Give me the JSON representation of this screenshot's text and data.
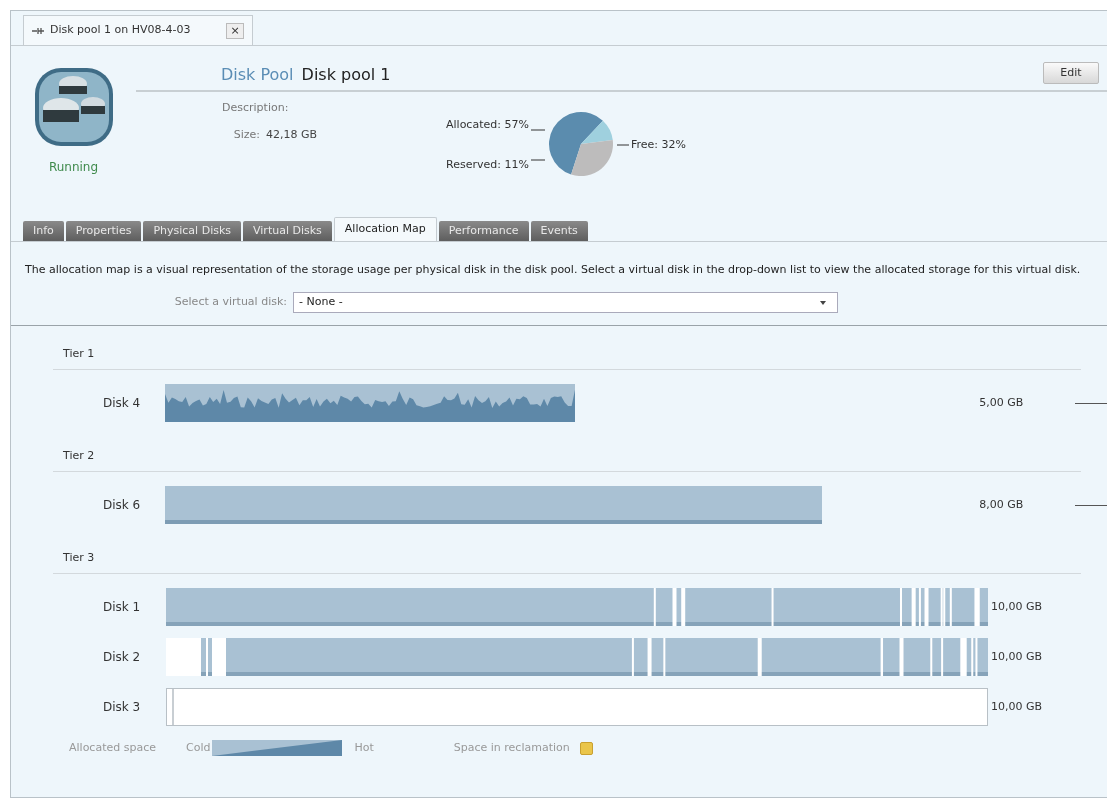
{
  "document_tab": {
    "title": "Disk pool 1 on HV08-4-03",
    "close": "×"
  },
  "header": {
    "status": "Running",
    "type_label": "Disk Pool",
    "name": "Disk pool 1",
    "description_label": "Description:",
    "size_label": "Size:",
    "size_value": "42,18 GB",
    "edit_button": "Edit",
    "chart_data": {
      "type": "pie",
      "categories": [
        "Allocated: 57%",
        "Reserved: 11%",
        "Free: 32%"
      ],
      "values": [
        57,
        11,
        32
      ]
    }
  },
  "tabs": [
    {
      "label": "Info",
      "selected": false
    },
    {
      "label": "Properties",
      "selected": false
    },
    {
      "label": "Physical Disks",
      "selected": false
    },
    {
      "label": "Virtual Disks",
      "selected": false
    },
    {
      "label": "Allocation Map",
      "selected": true
    },
    {
      "label": "Performance",
      "selected": false
    },
    {
      "label": "Events",
      "selected": false
    }
  ],
  "intro": "The allocation map is a visual representation of the storage usage per physical disk in the disk pool. Select a virtual disk in the drop-down list to view the allocated storage for this virtual disk.",
  "virtual_disk_select": {
    "label": "Select a virtual disk:",
    "value": "- None -"
  },
  "tiers": [
    {
      "name": "Tier 1",
      "disks": [
        {
          "name": "Disk 4",
          "kind": "hot",
          "size": "5,00 GB"
        }
      ]
    },
    {
      "name": "Tier 2",
      "disks": [
        {
          "name": "Disk 6",
          "kind": "cold",
          "size": "8,00 GB"
        }
      ]
    },
    {
      "name": "Tier 3",
      "disks": [
        {
          "name": "Disk 1",
          "kind": "fragmented",
          "size": "10,00 GB"
        },
        {
          "name": "Disk 2",
          "kind": "fragmented",
          "size": "10,00 GB"
        },
        {
          "name": "Disk 3",
          "kind": "empty",
          "size": "10,00 GB"
        }
      ]
    }
  ],
  "legend": {
    "allocated_label": "Allocated space",
    "cold": "Cold",
    "hot": "Hot",
    "reclamation_label": "Space in reclamation"
  }
}
